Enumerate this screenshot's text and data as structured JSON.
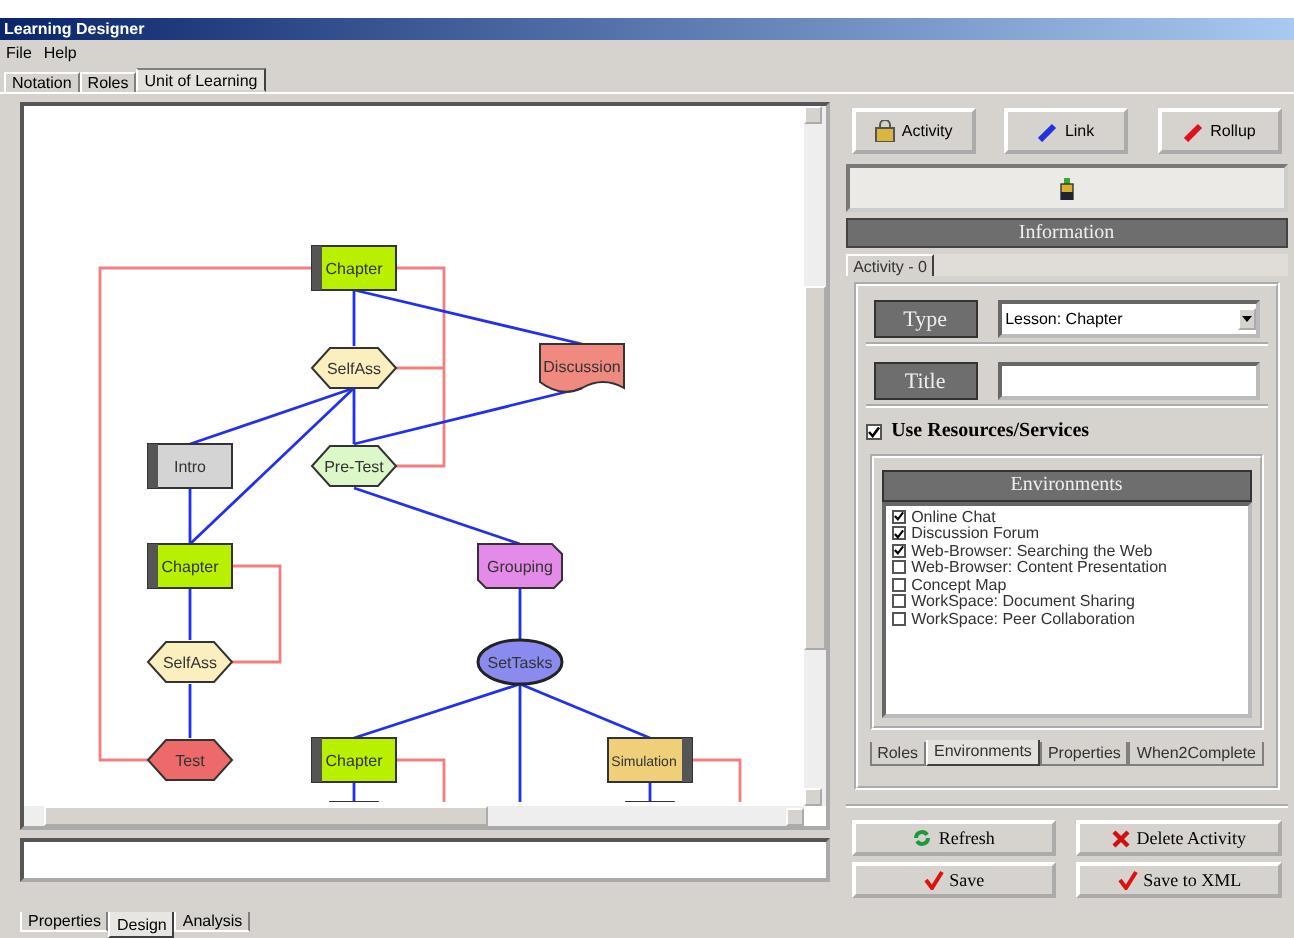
{
  "window": {
    "title": "Learning Designer"
  },
  "menu": [
    "File",
    "Help"
  ],
  "tabs": [
    {
      "label": "Notation",
      "selected": false
    },
    {
      "label": "Roles",
      "selected": false
    },
    {
      "label": "Unit of Learning",
      "selected": true
    }
  ],
  "diagram": {
    "nodes": [
      {
        "label": "Chapter",
        "kind": "chapter"
      },
      {
        "label": "SelfAss",
        "kind": "selfass"
      },
      {
        "label": "Discussion",
        "kind": "discussion"
      },
      {
        "label": "Intro",
        "kind": "intro"
      },
      {
        "label": "Pre-Test",
        "kind": "pretest"
      },
      {
        "label": "Chapter",
        "kind": "chapter"
      },
      {
        "label": "Grouping",
        "kind": "grouping"
      },
      {
        "label": "SelfAss",
        "kind": "selfass"
      },
      {
        "label": "SetTasks",
        "kind": "settasks"
      },
      {
        "label": "Test",
        "kind": "test"
      },
      {
        "label": "Chapter",
        "kind": "chapter"
      },
      {
        "label": "Simulation",
        "kind": "simulation"
      }
    ]
  },
  "toolbar": [
    {
      "label": "Activity",
      "kind": "activity"
    },
    {
      "label": "Link",
      "kind": "link"
    },
    {
      "label": "Rollup",
      "kind": "rollup"
    }
  ],
  "information": {
    "header": "Information",
    "tabs": [
      {
        "label": "Activity - 0",
        "selected": true
      }
    ],
    "type_label": "Type",
    "type_value": "Lesson: Chapter",
    "title_label": "Title",
    "use_resources": {
      "label": "Use Resources/Services",
      "checked": true
    },
    "environments": {
      "header": "Environments",
      "items": [
        {
          "label": "Online Chat",
          "checked": true
        },
        {
          "label": "Discussion Forum",
          "checked": true
        },
        {
          "label": "Web-Browser: Searching the Web",
          "checked": true
        },
        {
          "label": "Web-Browser: Content Presentation",
          "checked": false
        },
        {
          "label": "Concept Map",
          "checked": false
        },
        {
          "label": "WorkSpace: Document Sharing",
          "checked": false
        },
        {
          "label": "WorkSpace: Peer Collaboration",
          "checked": false
        }
      ]
    },
    "sub_tabs": [
      {
        "label": "Roles",
        "selected": false
      },
      {
        "label": "Environments",
        "selected": true
      },
      {
        "label": "Properties",
        "selected": false
      },
      {
        "label": "When2Complete",
        "selected": false
      }
    ]
  },
  "actions": [
    {
      "label": "Refresh",
      "kind": "refresh"
    },
    {
      "label": "Delete Activity",
      "kind": "delete"
    },
    {
      "label": "Save",
      "kind": "save"
    },
    {
      "label": "Save to XML",
      "kind": "save"
    }
  ],
  "bottom_tabs": [
    {
      "label": "Properties",
      "selected": false
    },
    {
      "label": "Design",
      "selected": true
    },
    {
      "label": "Analysis",
      "selected": false
    }
  ]
}
